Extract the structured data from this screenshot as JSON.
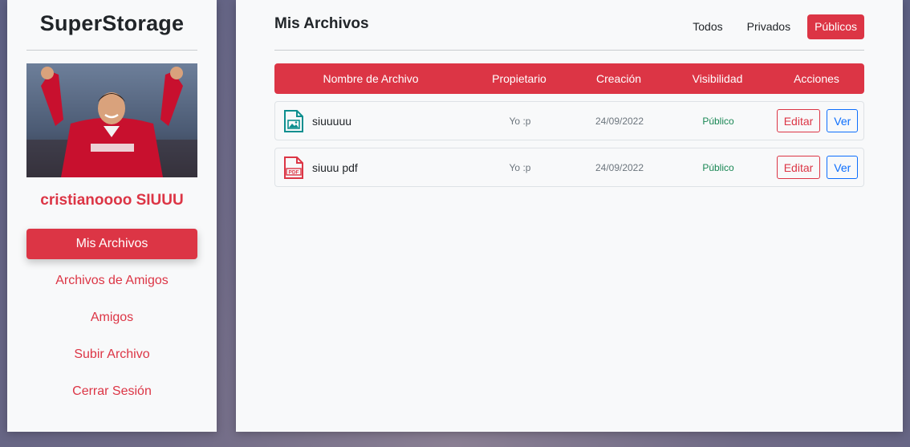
{
  "sidebar": {
    "brand": "SuperStorage",
    "username": "cristianoooo SIUUU",
    "items": [
      {
        "label": "Mis Archivos",
        "active": true
      },
      {
        "label": "Archivos de Amigos",
        "active": false
      },
      {
        "label": "Amigos",
        "active": false
      },
      {
        "label": "Subir Archivo",
        "active": false
      },
      {
        "label": "Cerrar Sesión",
        "active": false
      }
    ]
  },
  "main": {
    "title": "Mis Archivos",
    "filters": [
      {
        "label": "Todos",
        "active": false
      },
      {
        "label": "Privados",
        "active": false
      },
      {
        "label": "Públicos",
        "active": true
      }
    ],
    "table": {
      "headers": [
        "Nombre de Archivo",
        "Propietario",
        "Creación",
        "Visibilidad",
        "Acciones"
      ],
      "rows": [
        {
          "icon": "image-file-icon",
          "name": "siuuuuu",
          "owner": "Yo :p",
          "created": "24/09/2022",
          "visibility": "Público",
          "edit_label": "Editar",
          "view_label": "Ver"
        },
        {
          "icon": "pdf-file-icon",
          "name": "siuuu pdf",
          "owner": "Yo :p",
          "created": "24/09/2022",
          "visibility": "Público",
          "edit_label": "Editar",
          "view_label": "Ver"
        }
      ]
    }
  },
  "colors": {
    "accent": "#dc3545",
    "link": "#0d6efd",
    "success": "#198754"
  }
}
